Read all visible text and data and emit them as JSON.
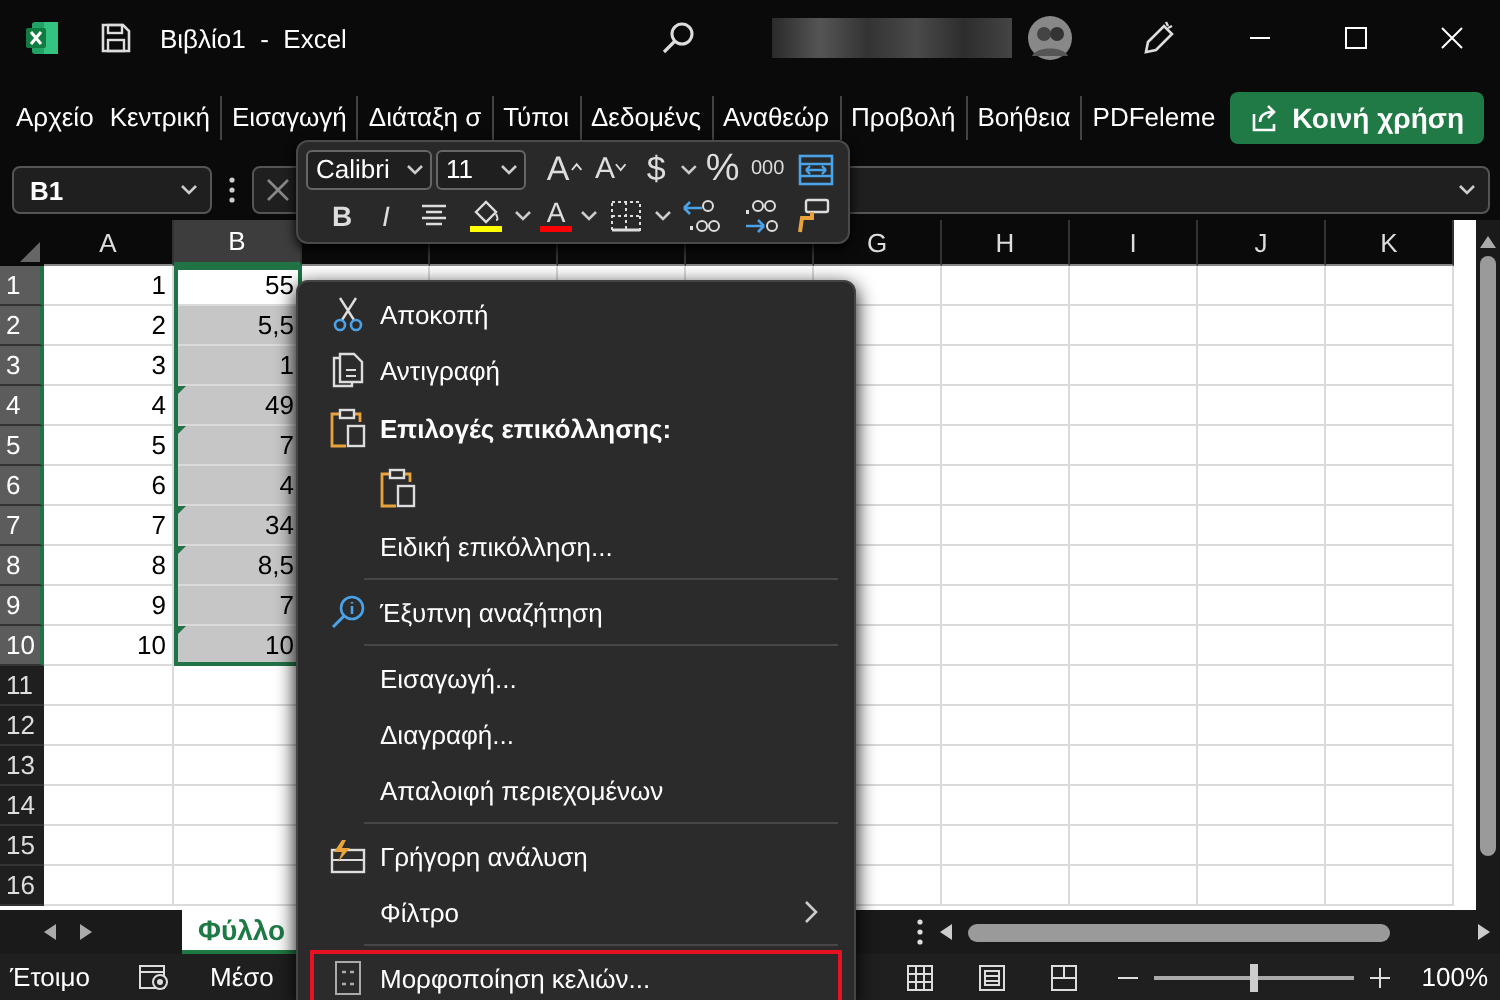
{
  "title_bar": {
    "document_title": "Βιβλίο1  -  Excel"
  },
  "ribbon": {
    "tabs": [
      {
        "label": "Αρχείο",
        "selected": false
      },
      {
        "label": "Κεντρική",
        "selected": false
      },
      {
        "label": "Εισαγωγή",
        "selected": false
      },
      {
        "label": "Διάταξη σ",
        "selected": false
      },
      {
        "label": "Τύποι",
        "selected": false
      },
      {
        "label": "Δεδομένς",
        "selected": false
      },
      {
        "label": "Αναθεώρ",
        "selected": false
      },
      {
        "label": "Προβολή",
        "selected": false
      },
      {
        "label": "Βοήθεια",
        "selected": false
      },
      {
        "label": "PDFeleme",
        "selected": false
      }
    ],
    "share_button": "Κοινή χρήση"
  },
  "formula_bar": {
    "name_box": "B1"
  },
  "mini_toolbar": {
    "font_name": "Calibri",
    "font_size": "11",
    "buttons": [
      {
        "kind": "grow",
        "label": "A"
      },
      {
        "kind": "shrink",
        "label": "A"
      },
      {
        "kind": "currency",
        "label": "$"
      },
      {
        "kind": "percent",
        "label": "%"
      },
      {
        "kind": "comma",
        "label": "000"
      },
      {
        "kind": "wrap"
      },
      {
        "kind": "bold",
        "label": "B"
      },
      {
        "kind": "italic",
        "label": "I"
      },
      {
        "kind": "align"
      },
      {
        "kind": "fill",
        "color": "#ffff00"
      },
      {
        "kind": "font_color",
        "label": "A",
        "color": "#ff0000"
      },
      {
        "kind": "borders"
      },
      {
        "kind": "decrease_decimal"
      },
      {
        "kind": "increase_decimal"
      },
      {
        "kind": "painter"
      }
    ]
  },
  "grid": {
    "columns": [
      {
        "label": "A",
        "selected": false
      },
      {
        "label": "B",
        "selected": true
      },
      {
        "selected": false
      },
      {
        "selected": false
      },
      {
        "selected": false
      },
      {
        "selected": false
      },
      {
        "label": "G",
        "selected": false
      },
      {
        "label": "H",
        "selected": false
      },
      {
        "label": "I",
        "selected": false
      },
      {
        "label": "J",
        "selected": false
      },
      {
        "label": "K",
        "selected": false
      }
    ],
    "rows": [
      {
        "header": "1",
        "selected": true,
        "cells": [
          {
            "text": "1"
          },
          {
            "text": "55",
            "selected": true,
            "active": true,
            "flag": false
          }
        ]
      },
      {
        "header": "2",
        "selected": true,
        "cells": [
          {
            "text": "2"
          },
          {
            "text": "5,5",
            "selected": true,
            "active": false,
            "flag": false
          }
        ]
      },
      {
        "header": "3",
        "selected": true,
        "cells": [
          {
            "text": "3"
          },
          {
            "text": "1",
            "selected": true,
            "active": false,
            "flag": false
          }
        ]
      },
      {
        "header": "4",
        "selected": true,
        "cells": [
          {
            "text": "4"
          },
          {
            "text": "49",
            "selected": true,
            "active": false,
            "flag": true
          }
        ]
      },
      {
        "header": "5",
        "selected": true,
        "cells": [
          {
            "text": "5"
          },
          {
            "text": "7",
            "selected": true,
            "active": false,
            "flag": true
          }
        ]
      },
      {
        "header": "6",
        "selected": true,
        "cells": [
          {
            "text": "6"
          },
          {
            "text": "4",
            "selected": true,
            "active": false,
            "flag": false
          }
        ]
      },
      {
        "header": "7",
        "selected": true,
        "cells": [
          {
            "text": "7"
          },
          {
            "text": "34",
            "selected": true,
            "active": false,
            "flag": true
          }
        ]
      },
      {
        "header": "8",
        "selected": true,
        "cells": [
          {
            "text": "8"
          },
          {
            "text": "8,5",
            "selected": true,
            "active": false,
            "flag": true
          }
        ]
      },
      {
        "header": "9",
        "selected": true,
        "cells": [
          {
            "text": "9"
          },
          {
            "text": "7",
            "selected": true,
            "active": false,
            "flag": false
          }
        ]
      },
      {
        "header": "10",
        "selected": true,
        "cells": [
          {
            "text": "10"
          },
          {
            "text": "10",
            "selected": true,
            "active": false,
            "flag": true
          }
        ]
      },
      {
        "header": "11",
        "selected": false
      },
      {
        "header": "12",
        "selected": false
      },
      {
        "header": "13",
        "selected": false
      },
      {
        "header": "14",
        "selected": false
      },
      {
        "header": "15",
        "selected": false
      },
      {
        "header": "16",
        "selected": false
      }
    ]
  },
  "sheet_tabs": [
    {
      "label": "Φύλλο",
      "selected": true
    }
  ],
  "context_menu": {
    "items": [
      {
        "kind": "cut",
        "label": "Αποκοπή"
      },
      {
        "kind": "copy",
        "label": "Αντιγραφή"
      },
      {
        "kind": "paste_header",
        "label": "Επιλογές επικόλλησης:"
      },
      {
        "kind": "paste_option"
      },
      {
        "kind": "item",
        "label": "Ειδική επικόλληση..."
      },
      {
        "kind": "separator"
      },
      {
        "kind": "smart_lookup",
        "label": "Έξυπνη αναζήτηση"
      },
      {
        "kind": "separator"
      },
      {
        "kind": "item",
        "label": "Εισαγωγή..."
      },
      {
        "kind": "item",
        "label": "Διαγραφή..."
      },
      {
        "kind": "item",
        "label": "Απαλοιφή περιεχομένων"
      },
      {
        "kind": "separator"
      },
      {
        "kind": "quick_analysis",
        "label": "Γρήγορη ανάλυση"
      },
      {
        "kind": "submenu",
        "label": "Φίλτρο"
      },
      {
        "kind": "separator"
      },
      {
        "kind": "format_cells",
        "label": "Μορφοποίηση κελιών...",
        "highlighted": true
      }
    ]
  },
  "status_bar": {
    "mode": "Έτοιμο",
    "summary": "Μέσο",
    "zoom_slider": {
      "level": 0.5
    },
    "zoom": "100%"
  }
}
